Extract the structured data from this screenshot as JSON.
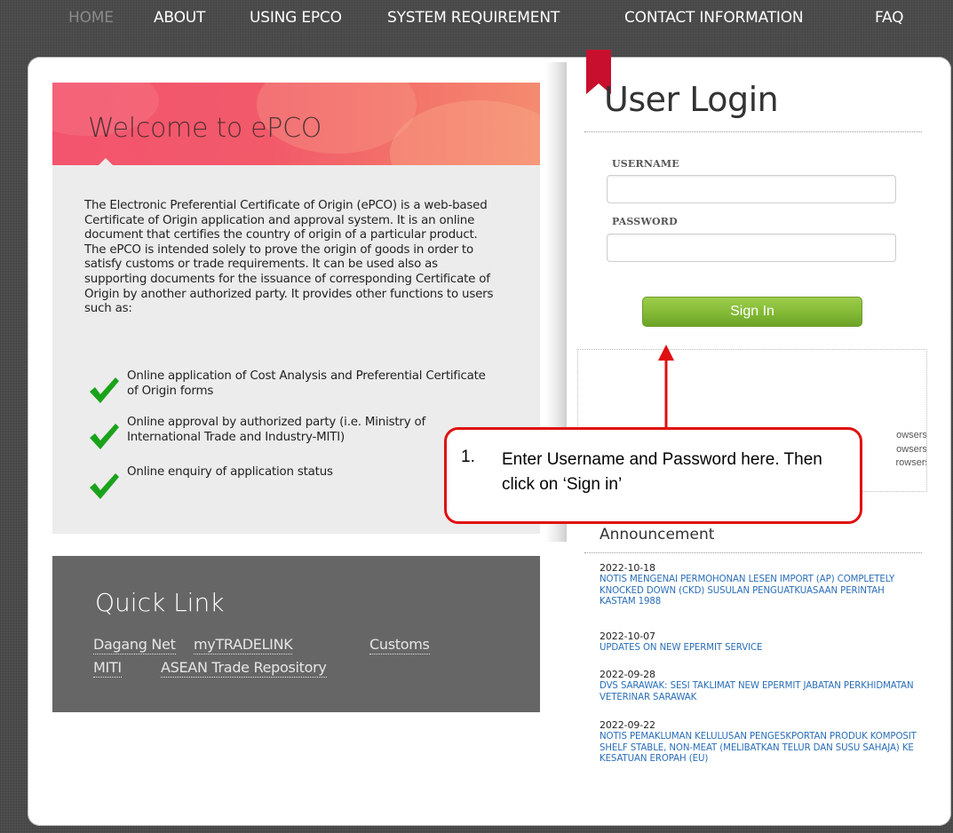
{
  "nav": {
    "items": [
      {
        "label": "HOME",
        "active": true
      },
      {
        "label": "ABOUT"
      },
      {
        "label": "USING EPCO"
      },
      {
        "label": "SYSTEM REQUIREMENT"
      },
      {
        "label": "CONTACT INFORMATION"
      },
      {
        "label": "FAQ"
      }
    ]
  },
  "welcome": {
    "title": "Welcome to ePCO",
    "paragraph": "The Electronic Preferential Certificate of Origin (ePCO) is a web-based Certificate of Origin application and approval system. It is an online document that certifies the country of origin of a particular product. The ePCO is intended solely to prove the origin of goods in order to satisfy customs or trade requirements. It can be used also as supporting documents for the issuance of corresponding Certificate of Origin by another authorized party. It provides other functions to users such as:",
    "features": [
      "Online application of Cost Analysis and Preferential Certificate of Origin forms",
      "Online approval by authorized party (i.e. Ministry of International Trade and Industry-MITI)",
      "Online enquiry of application status"
    ]
  },
  "quicklink": {
    "title": "Quick Link",
    "links": [
      "Dagang Net",
      "myTRADELINK",
      "Customs",
      "MITI",
      "ASEAN Trade Repository"
    ]
  },
  "login": {
    "title": "User Login",
    "username_label": "USERNAME",
    "username_value": "",
    "password_label": "PASSWORD",
    "password_value": "",
    "signin_label": "Sign In",
    "browser_lines": [
      "owsers.",
      "owsers,",
      "rowsers"
    ]
  },
  "announcement": {
    "title": "Announcement",
    "items": [
      {
        "date": "2022-10-18",
        "text": "NOTIS MENGENAI PERMOHONAN LESEN IMPORT (AP) COMPLETELY KNOCKED DOWN (CKD) SUSULAN PENGUATKUASAAN PERINTAH KASTAM 1988"
      },
      {
        "date": "2022-10-07",
        "text": "UPDATES ON NEW EPERMIT SERVICE"
      },
      {
        "date": "2022-09-28",
        "text": "DVS SARAWAK: SESI TAKLIMAT NEW EPERMIT JABATAN PERKHIDMATAN VETERINAR SARAWAK"
      },
      {
        "date": "2022-09-22",
        "text": "NOTIS PEMAKLUMAN KELULUSAN PENGESKPORTAN PRODUK KOMPOSIT SHELF STABLE, NON-MEAT (MELIBATKAN TELUR DAN SUSU SAHAJA) KE KESATUAN EROPAH (EU)"
      }
    ]
  },
  "callout": {
    "number": "1.",
    "text": "Enter Username and Password here. Then click on ‘Sign in’"
  },
  "colors": {
    "callout_border": "#e01010",
    "signin_green": "#86bb37",
    "link_blue": "#2a6eb8",
    "ribbon_red": "#c8102e",
    "check_green": "#1aa31a",
    "banner_pink": "#f3546e"
  },
  "icons": {
    "check": "check-icon",
    "ribbon": "bookmark-ribbon-icon",
    "arrow": "arrow-up-icon"
  }
}
